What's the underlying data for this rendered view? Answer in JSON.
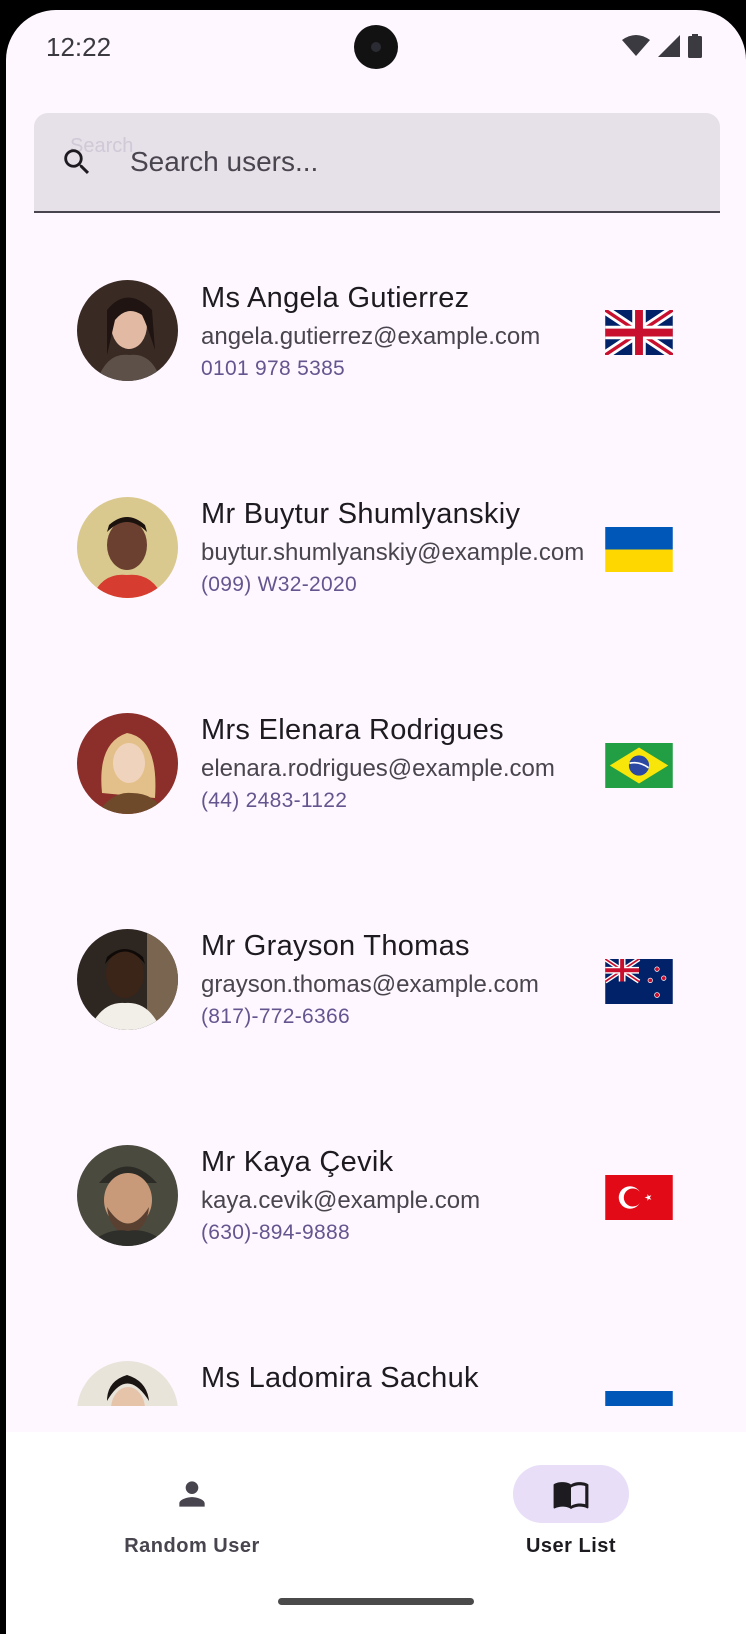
{
  "status_bar": {
    "time": "12:22",
    "icons": [
      "wifi-icon",
      "cellular-signal-icon",
      "battery-icon"
    ]
  },
  "search": {
    "floating_label": "Search",
    "placeholder": "Search users...",
    "icon": "search-icon"
  },
  "users": [
    {
      "name": "Ms Angela Gutierrez",
      "email": "angela.gutierrez@example.com",
      "phone": "0101 978 5385",
      "flag": "gb"
    },
    {
      "name": "Mr Buytur Shumlyanskiy",
      "email": "buytur.shumlyanskiy@example.com",
      "phone": "(099) W32-2020",
      "flag": "ua"
    },
    {
      "name": "Mrs Elenara Rodrigues",
      "email": "elenara.rodrigues@example.com",
      "phone": "(44) 2483-1122",
      "flag": "br"
    },
    {
      "name": "Mr Grayson Thomas",
      "email": "grayson.thomas@example.com",
      "phone": "(817)-772-6366",
      "flag": "nz"
    },
    {
      "name": "Mr Kaya Çevik",
      "email": "kaya.cevik@example.com",
      "phone": "(630)-894-9888",
      "flag": "tr"
    },
    {
      "name": "Ms Ladomira Sachuk",
      "email": "",
      "phone": "",
      "flag": "ua"
    }
  ],
  "bottom_nav": {
    "items": [
      {
        "label": "Random User",
        "icon": "person-icon",
        "active": false
      },
      {
        "label": "User List",
        "icon": "book-icon",
        "active": true
      }
    ]
  },
  "colors": {
    "background": "#FEF7FF",
    "search_bg": "#E6E0E9",
    "phone_text": "#65558F",
    "nav_indicator": "#E8DEF8"
  }
}
